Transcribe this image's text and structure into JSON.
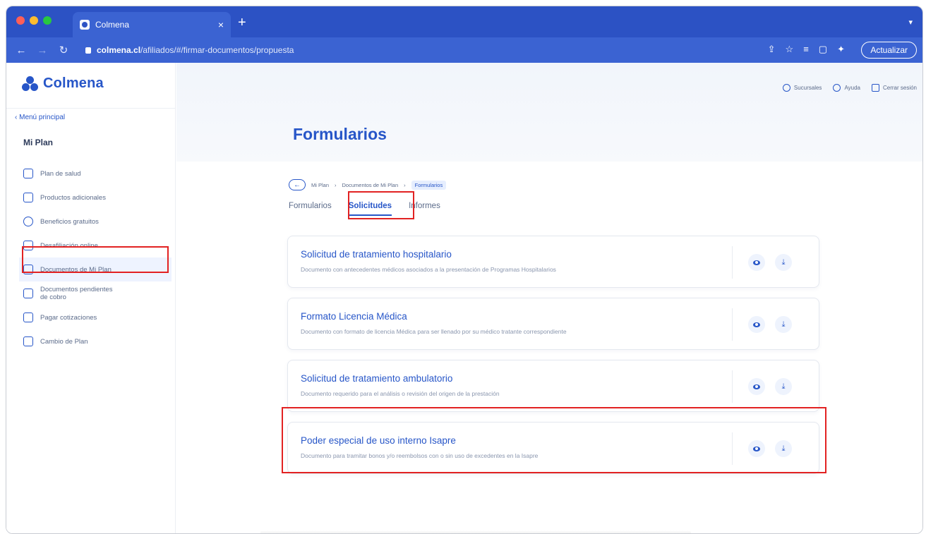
{
  "browser": {
    "tab_title": "Colmena",
    "tab_close": "×",
    "new_tab": "+",
    "url_host": "colmena.cl",
    "url_path": "/afiliados/#/firmar-documentos/propuesta",
    "update_label": "Actualizar",
    "traffic_colors": [
      "#ff5f57",
      "#febc2e",
      "#28c840"
    ]
  },
  "brand": {
    "name": "Colmena",
    "color": "#2756c8"
  },
  "sidebar": {
    "back_label": "‹ Menú principal",
    "title": "Mi Plan",
    "items": [
      {
        "label": "Plan de salud",
        "icon": "document-icon"
      },
      {
        "label": "Productos adicionales",
        "icon": "box-icon"
      },
      {
        "label": "Beneficios gratuitos",
        "icon": "badge-icon"
      },
      {
        "label": "Desafiliación online",
        "icon": "exit-icon"
      },
      {
        "label": "Documentos de Mi Plan",
        "icon": "folder-icon"
      },
      {
        "label": "Documentos pendientes de cobro",
        "icon": "pending-icon"
      },
      {
        "label": "Pagar cotizaciones",
        "icon": "payment-icon"
      },
      {
        "label": "Cambio de Plan",
        "icon": "swap-icon"
      }
    ]
  },
  "header": {
    "links": [
      {
        "label": "Sucursales",
        "icon": "location-icon"
      },
      {
        "label": "Ayuda",
        "icon": "help-icon"
      },
      {
        "label": "Cerrar sesión",
        "icon": "logout-icon"
      }
    ],
    "page_title": "Formularios"
  },
  "breadcrumb": {
    "items": [
      "Mi Plan",
      "Documentos de Mi Plan",
      "Formularios"
    ],
    "separator": "›"
  },
  "tabs": [
    {
      "label": "Formularios"
    },
    {
      "label": "Solicitudes"
    },
    {
      "label": "Informes"
    }
  ],
  "cards": [
    {
      "title": "Solicitud de tratamiento hospitalario",
      "desc": "Documento con antecedentes médicos asociados a la presentación de Programas Hospitalarios"
    },
    {
      "title": "Formato Licencia Médica",
      "desc": "Documento con formato de licencia Médica para ser llenado por su médico tratante correspondiente"
    },
    {
      "title": "Solicitud de tratamiento ambulatorio",
      "desc": "Documento requerido para el análisis o revisión del origen de la prestación"
    },
    {
      "title": "Poder especial de uso interno Isapre",
      "desc": "Documento para tramitar bonos y/o reembolsos con o sin uso de excedentes en la Isapre"
    }
  ],
  "highlight_color": "#e22222"
}
